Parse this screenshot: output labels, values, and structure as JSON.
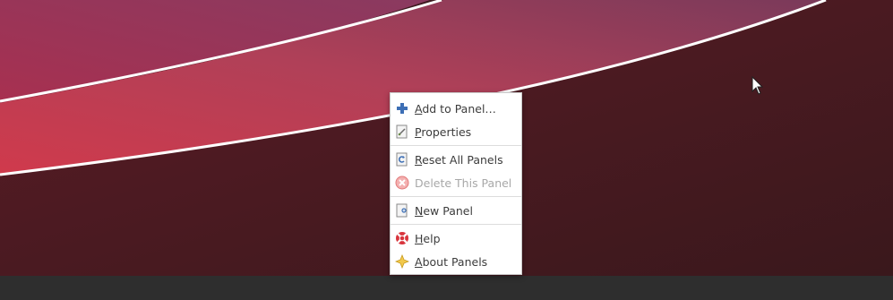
{
  "menu": {
    "items": [
      {
        "first": "A",
        "rest": "dd to Panel…",
        "icon": "add-icon",
        "enabled": true
      },
      {
        "first": "P",
        "rest": "roperties",
        "icon": "properties-icon",
        "enabled": true
      },
      {
        "first": "R",
        "rest": "eset All Panels",
        "icon": "reset-icon",
        "enabled": true
      },
      {
        "first": "",
        "rest": "Delete This Panel",
        "icon": "delete-icon",
        "enabled": false
      },
      {
        "first": "N",
        "rest": "ew Panel",
        "icon": "new-panel-icon",
        "enabled": true
      },
      {
        "first": "H",
        "rest": "elp",
        "icon": "help-icon",
        "enabled": true
      },
      {
        "first": "A",
        "rest": "bout Panels",
        "icon": "about-icon",
        "enabled": true
      }
    ]
  },
  "colors": {
    "panel_bar": "#2e2e2e",
    "menu_background": "#ffffff",
    "menu_text": "#3c3c3c",
    "disabled_text": "#a8a8a8",
    "wallpaper_dark": "#3a1a20",
    "wallpaper_red": "#c8384e"
  }
}
